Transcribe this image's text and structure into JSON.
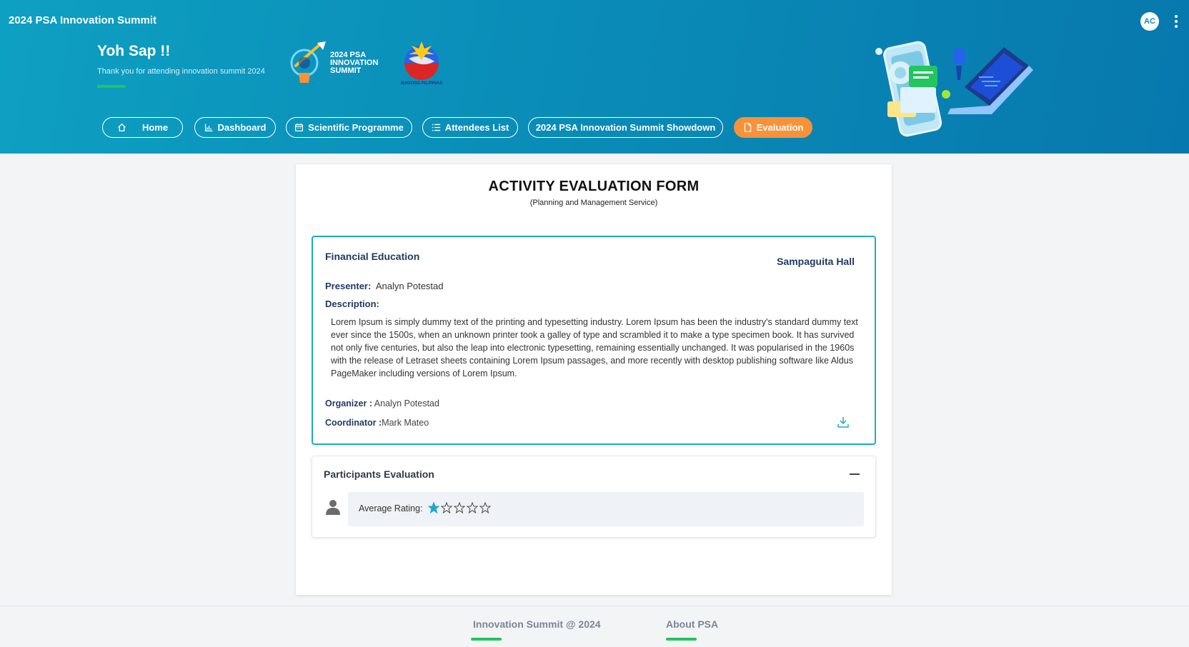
{
  "header": {
    "app_title": "2024 PSA Innovation Summit",
    "avatar_initials": "AC",
    "greeting": "Yoh Sap !!",
    "greeting_sub": "Thank you for attending innovation summit 2024",
    "logo_lines": [
      "2024 PSA",
      "INNOVATION",
      "SUMMIT"
    ],
    "seal_caption": "BAGONG PILIPINAS"
  },
  "nav": [
    {
      "label": "Home",
      "icon": "home-icon"
    },
    {
      "label": "Dashboard",
      "icon": "bar-chart-icon"
    },
    {
      "label": "Scientific Programme",
      "icon": "calendar-icon"
    },
    {
      "label": "Attendees List",
      "icon": "list-icon"
    },
    {
      "label": "2024 PSA Innovation Summit Showdown",
      "icon": ""
    },
    {
      "label": "Evaluation",
      "icon": "document-icon",
      "active": true
    }
  ],
  "form": {
    "title": "ACTIVITY EVALUATION FORM",
    "subtitle": "(Planning and Management Service)"
  },
  "session": {
    "title": "Financial Education",
    "venue": "Sampaguita Hall",
    "presenter_label": "Presenter:",
    "presenter": "Analyn Potestad",
    "description_label": "Description:",
    "description": "Lorem Ipsum is simply dummy text of the printing and typesetting industry. Lorem Ipsum has been the industry's standard dummy text ever since the 1500s, when an unknown printer took a galley of type and scrambled it to make a type specimen book. It has survived not only five centuries, but also the leap into electronic typesetting, remaining essentially unchanged. It was popularised in the 1960s with the release of Letraset sheets containing Lorem Ipsum passages, and more recently with desktop publishing software like Aldus PageMaker including versions of Lorem Ipsum.",
    "organizer_label": "Organizer :",
    "organizer": "Analyn Potestad",
    "coordinator_label": "Coordinator :",
    "coordinator": "Mark Mateo"
  },
  "evaluation": {
    "title": "Participants Evaluation",
    "rating_label": "Average Rating:",
    "rating_value": 1,
    "rating_max": 5
  },
  "footer": {
    "links": [
      "Innovation Summit @ 2024",
      "About PSA"
    ]
  },
  "colors": {
    "accent": "#0a8db8",
    "active_nav": "#f7923a",
    "star": "#1fa9c9",
    "underline": "#22c55e"
  }
}
